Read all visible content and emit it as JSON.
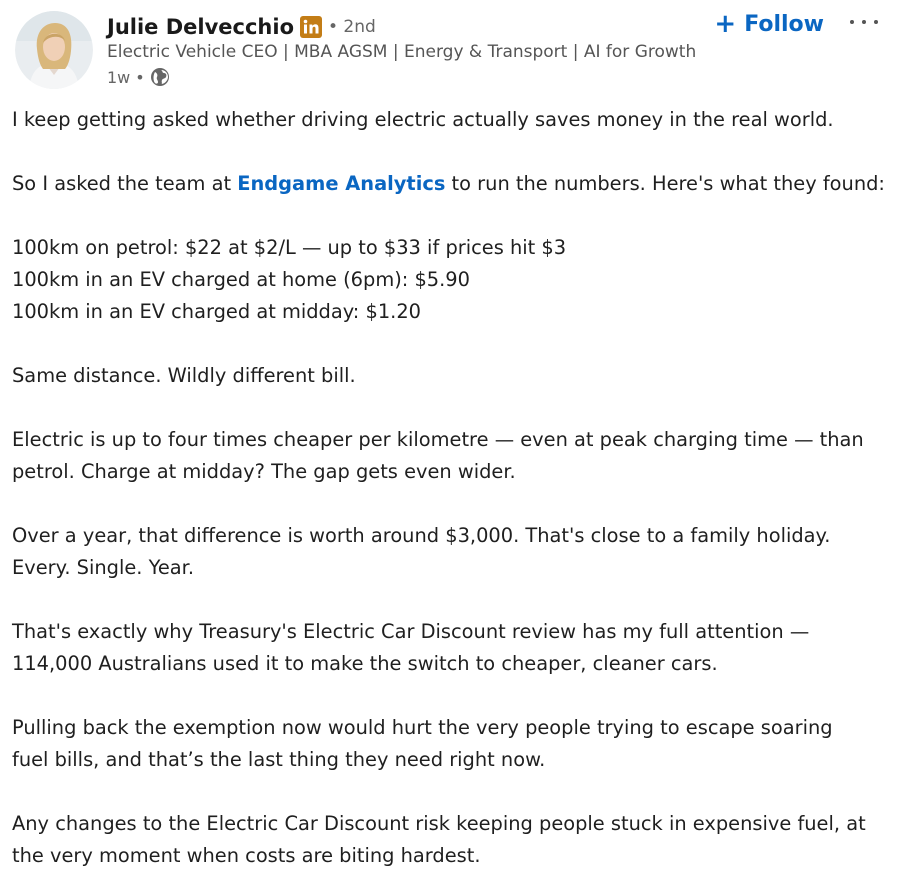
{
  "author": {
    "name": "Julie Delvecchio",
    "badge_icon": "linkedin-icon",
    "degree": "• 2nd",
    "headline": "Electric Vehicle CEO | MBA AGSM | Energy & Transport | AI for Growth",
    "time": "1w",
    "dot": "•",
    "visibility_icon": "globe-icon"
  },
  "actions": {
    "follow_label": "Follow",
    "follow_icon": "+",
    "more_icon": "more-icon"
  },
  "post": {
    "line1": "I keep getting asked whether driving electric actually saves money in the real world.",
    "line2_before": "So I asked the team at ",
    "line2_mention": "Endgame Analytics",
    "line2_after": " to run the numbers. Here's what they found:",
    "line3": "100km on petrol: $22 at $2/L — up to $33 if prices hit $3",
    "line4": "100km in an EV charged at home (6pm): $5.90",
    "line5": "100km in an EV charged at midday: $1.20",
    "line6": "Same distance. Wildly different bill.",
    "line7": "Electric is up to four times cheaper per kilometre — even at peak charging time — than",
    "line8": "petrol. Charge at midday? The gap gets even wider.",
    "line9": "Over a year, that difference is worth around $3,000. That's close to a family holiday.",
    "line10": "Every. Single. Year.",
    "line11": "That's exactly why Treasury's Electric Car Discount review has my full attention —",
    "line12": "114,000 Australians used it to make the switch to cheaper, cleaner cars.",
    "line13": "Pulling back the exemption now would hurt the very people trying to escape soaring",
    "line14": "fuel bills, and that’s the last thing they need right now.",
    "line15": "Any changes to the Electric Car Discount risk keeping people stuck in expensive fuel, at",
    "line16": "the very moment when costs are biting hardest."
  },
  "colors": {
    "accent": "#0a66c2",
    "linkedin_badge": "#c37d16",
    "text": "#1f1f1f",
    "secondary_text": "#666666"
  }
}
